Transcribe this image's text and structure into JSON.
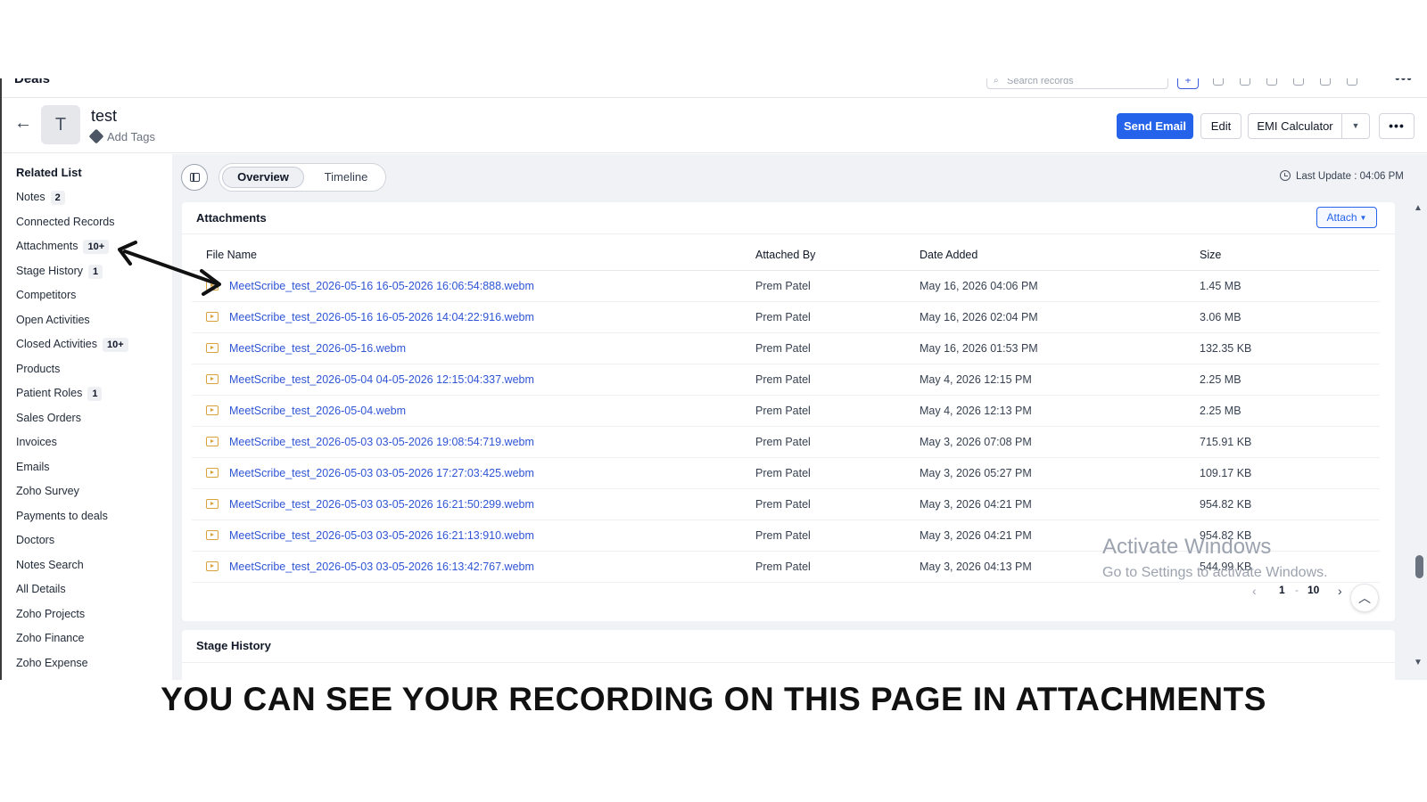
{
  "topbar": {
    "module": "Deals",
    "search_placeholder": "Search records",
    "plus": "+",
    "more": "•••"
  },
  "record": {
    "back": "←",
    "avatar_initial": "T",
    "title": "test",
    "add_tags": "Add Tags",
    "buttons": {
      "send_email": "Send Email",
      "edit": "Edit",
      "emi_calculator": "EMI Calculator",
      "dropdown_caret": "▼",
      "more": "•••"
    }
  },
  "sidebar": {
    "heading": "Related List",
    "items": [
      {
        "label": "Notes",
        "badge": "2"
      },
      {
        "label": "Connected Records",
        "badge": ""
      },
      {
        "label": "Attachments",
        "badge": "10+"
      },
      {
        "label": "Stage History",
        "badge": "1"
      },
      {
        "label": "Competitors",
        "badge": ""
      },
      {
        "label": "Open Activities",
        "badge": ""
      },
      {
        "label": "Closed Activities",
        "badge": "10+"
      },
      {
        "label": "Products",
        "badge": ""
      },
      {
        "label": "Patient Roles",
        "badge": "1"
      },
      {
        "label": "Sales Orders",
        "badge": ""
      },
      {
        "label": "Invoices",
        "badge": ""
      },
      {
        "label": "Emails",
        "badge": ""
      },
      {
        "label": "Zoho Survey",
        "badge": ""
      },
      {
        "label": "Payments to deals",
        "badge": ""
      },
      {
        "label": "Doctors",
        "badge": ""
      },
      {
        "label": "Notes Search",
        "badge": ""
      },
      {
        "label": "All Details",
        "badge": ""
      },
      {
        "label": "Zoho Projects",
        "badge": ""
      },
      {
        "label": "Zoho Finance",
        "badge": ""
      },
      {
        "label": "Zoho Expense",
        "badge": ""
      }
    ]
  },
  "tabs": {
    "overview": "Overview",
    "timeline": "Timeline",
    "last_update": "Last Update : 04:06 PM"
  },
  "attachments": {
    "title": "Attachments",
    "attach_button": "Attach",
    "columns": [
      "File Name",
      "Attached By",
      "Date Added",
      "Size"
    ],
    "rows": [
      {
        "name": "MeetScribe_test_2026-05-16 16-05-2026 16:06:54:888.webm",
        "by": "Prem Patel",
        "date": "May 16, 2026 04:06 PM",
        "size": "1.45 MB"
      },
      {
        "name": "MeetScribe_test_2026-05-16 16-05-2026 14:04:22:916.webm",
        "by": "Prem Patel",
        "date": "May 16, 2026 02:04 PM",
        "size": "3.06 MB"
      },
      {
        "name": "MeetScribe_test_2026-05-16.webm",
        "by": "Prem Patel",
        "date": "May 16, 2026 01:53 PM",
        "size": "132.35 KB"
      },
      {
        "name": "MeetScribe_test_2026-05-04 04-05-2026 12:15:04:337.webm",
        "by": "Prem Patel",
        "date": "May 4, 2026 12:15 PM",
        "size": "2.25 MB"
      },
      {
        "name": "MeetScribe_test_2026-05-04.webm",
        "by": "Prem Patel",
        "date": "May 4, 2026 12:13 PM",
        "size": "2.25 MB"
      },
      {
        "name": "MeetScribe_test_2026-05-03 03-05-2026 19:08:54:719.webm",
        "by": "Prem Patel",
        "date": "May 3, 2026 07:08 PM",
        "size": "715.91 KB"
      },
      {
        "name": "MeetScribe_test_2026-05-03 03-05-2026 17:27:03:425.webm",
        "by": "Prem Patel",
        "date": "May 3, 2026 05:27 PM",
        "size": "109.17 KB"
      },
      {
        "name": "MeetScribe_test_2026-05-03 03-05-2026 16:21:50:299.webm",
        "by": "Prem Patel",
        "date": "May 3, 2026 04:21 PM",
        "size": "954.82 KB"
      },
      {
        "name": "MeetScribe_test_2026-05-03 03-05-2026 16:21:13:910.webm",
        "by": "Prem Patel",
        "date": "May 3, 2026 04:21 PM",
        "size": "954.82 KB"
      },
      {
        "name": "MeetScribe_test_2026-05-03 03-05-2026 16:13:42:767.webm",
        "by": "Prem Patel",
        "date": "May 3, 2026 04:13 PM",
        "size": "544.99 KB"
      }
    ],
    "pager": {
      "prev": "‹",
      "current": "1",
      "separator": "-",
      "total": "10",
      "next": "›"
    }
  },
  "stage_history": {
    "title": "Stage History"
  },
  "watermark": {
    "line1": "Activate Windows",
    "line2": "Go to Settings to activate Windows."
  },
  "caption": "YOU CAN SEE YOUR RECORDING ON THIS PAGE IN ATTACHMENTS",
  "icons": {
    "search": "search-icon",
    "tag": "tag-icon",
    "clock": "clock-icon",
    "file": "video-file-icon",
    "arrow": "double-arrow-annotation"
  },
  "colors": {
    "primary": "#2563eb",
    "link": "#2f55d4",
    "file_icon": "#d9a23a",
    "panel_bg": "#f0f2f6"
  }
}
